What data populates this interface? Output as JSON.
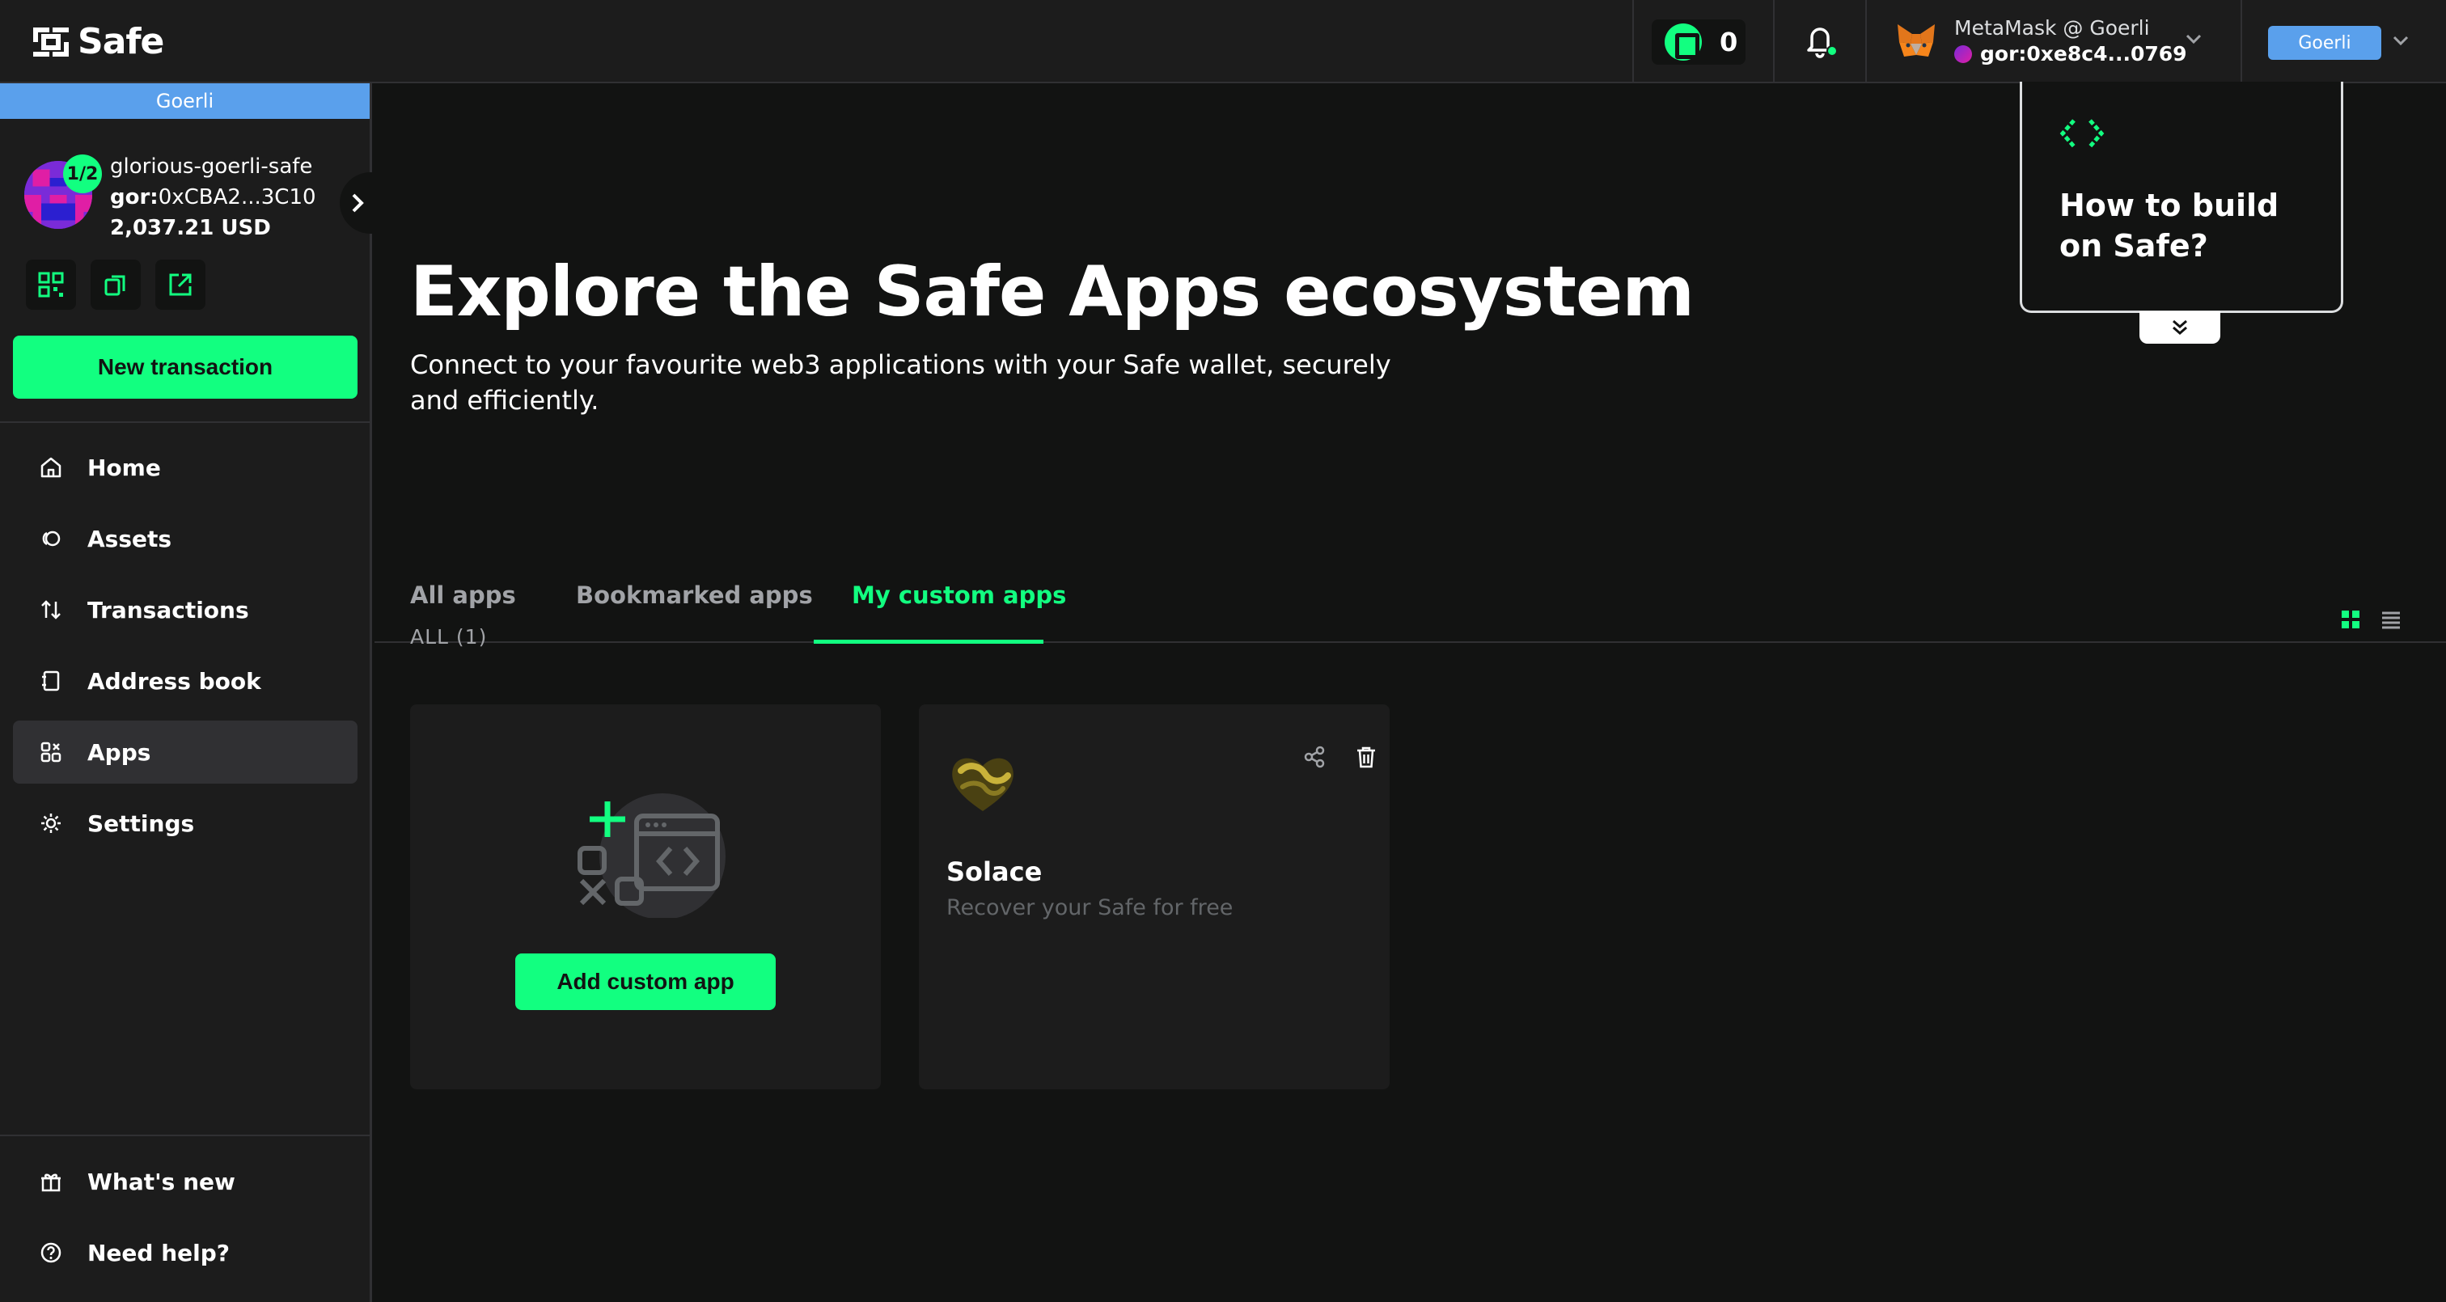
{
  "topbar": {
    "brand": "Safe",
    "token_count": "0",
    "wallet_name": "MetaMask @ Goerli",
    "wallet_address": "gor:0xe8c4...0769",
    "network": "Goerli"
  },
  "sidebar": {
    "network_strip": "Goerli",
    "safe": {
      "threshold": "1/2",
      "name": "glorious-goerli-safe",
      "address_prefix": "gor:",
      "address": "0xCBA2...3C10",
      "balance": "2,037.21 USD"
    },
    "new_transaction": "New transaction",
    "nav": [
      {
        "label": "Home",
        "icon": "home-icon"
      },
      {
        "label": "Assets",
        "icon": "assets-icon"
      },
      {
        "label": "Transactions",
        "icon": "transactions-icon"
      },
      {
        "label": "Address book",
        "icon": "address-book-icon"
      },
      {
        "label": "Apps",
        "icon": "apps-icon",
        "active": true
      },
      {
        "label": "Settings",
        "icon": "settings-icon"
      }
    ],
    "footer": [
      {
        "label": "What's new",
        "icon": "gift-icon"
      },
      {
        "label": "Need help?",
        "icon": "help-icon"
      }
    ]
  },
  "main": {
    "title": "Explore the Safe Apps ecosystem",
    "subtitle": "Connect to your favourite web3 applications with your Safe wallet, securely and efficiently.",
    "build_card_title": "How to build on Safe?",
    "tabs": [
      {
        "label": "All apps",
        "active": false
      },
      {
        "label": "Bookmarked apps",
        "active": false
      },
      {
        "label": "My custom apps",
        "active": true
      }
    ],
    "count_label": "ALL (1)",
    "add_custom_app": "Add custom app",
    "apps": [
      {
        "name": "Solace",
        "description": "Recover your Safe for free"
      }
    ]
  },
  "colors": {
    "accent": "#12ff80",
    "network": "#5aa0ec",
    "background": "#121312",
    "surface": "#1c1c1c",
    "border": "#303033"
  }
}
